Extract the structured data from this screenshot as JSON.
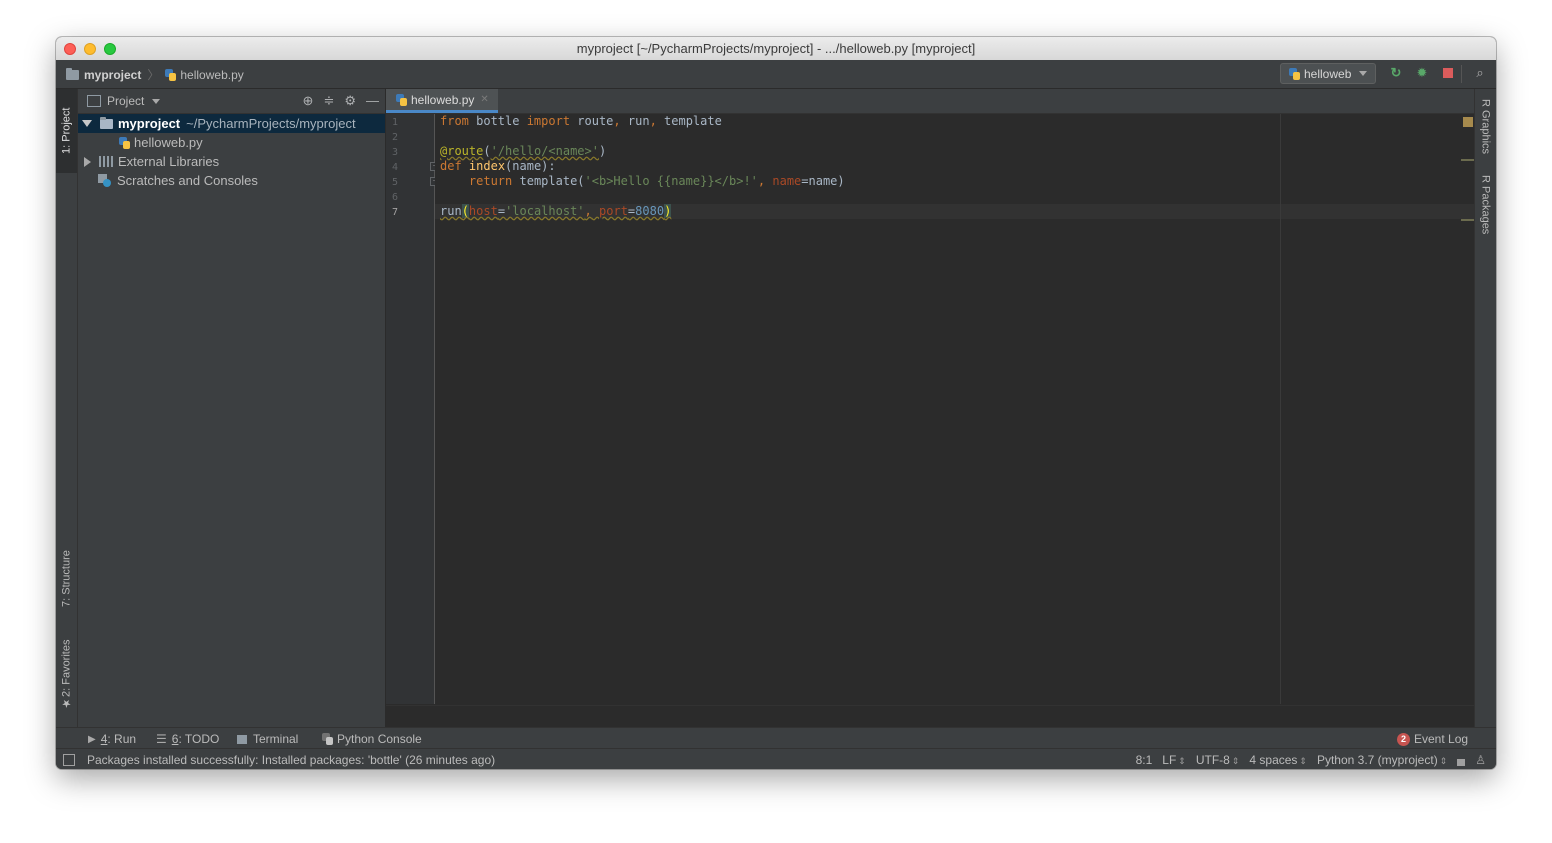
{
  "window": {
    "title": "myproject [~/PycharmProjects/myproject] - .../helloweb.py [myproject]"
  },
  "navbar": {
    "project": "myproject",
    "file": "helloweb.py",
    "run_config": "helloweb"
  },
  "left_tools": {
    "project_tab": "1: Project",
    "structure_tab": "7: Structure",
    "favorites_tab": "2: Favorites"
  },
  "right_tools": {
    "r_graphics": "R Graphics",
    "r_packages": "R Packages"
  },
  "project_panel": {
    "header": "Project",
    "tree": {
      "root_name": "myproject",
      "root_path": "~/PycharmProjects/myproject",
      "file": "helloweb.py",
      "external_libraries": "External Libraries",
      "scratches": "Scratches and Consoles"
    }
  },
  "editor": {
    "tab": "helloweb.py",
    "line_numbers": [
      "1",
      "2",
      "3",
      "4",
      "5",
      "6",
      "7"
    ]
  },
  "bottom_tabs": {
    "run_num": "4",
    "run_label": ": Run",
    "todo_num": "6",
    "todo_label": ": TODO",
    "terminal": "Terminal",
    "python_console": "Python Console",
    "event_log_count": "2",
    "event_log": "Event Log"
  },
  "status": {
    "message": "Packages installed successfully: Installed packages: 'bottle' (26 minutes ago)",
    "position": "8:1",
    "line_sep": "LF",
    "encoding": "UTF-8",
    "indent": "4 spaces",
    "interpreter": "Python 3.7 (myproject)"
  }
}
